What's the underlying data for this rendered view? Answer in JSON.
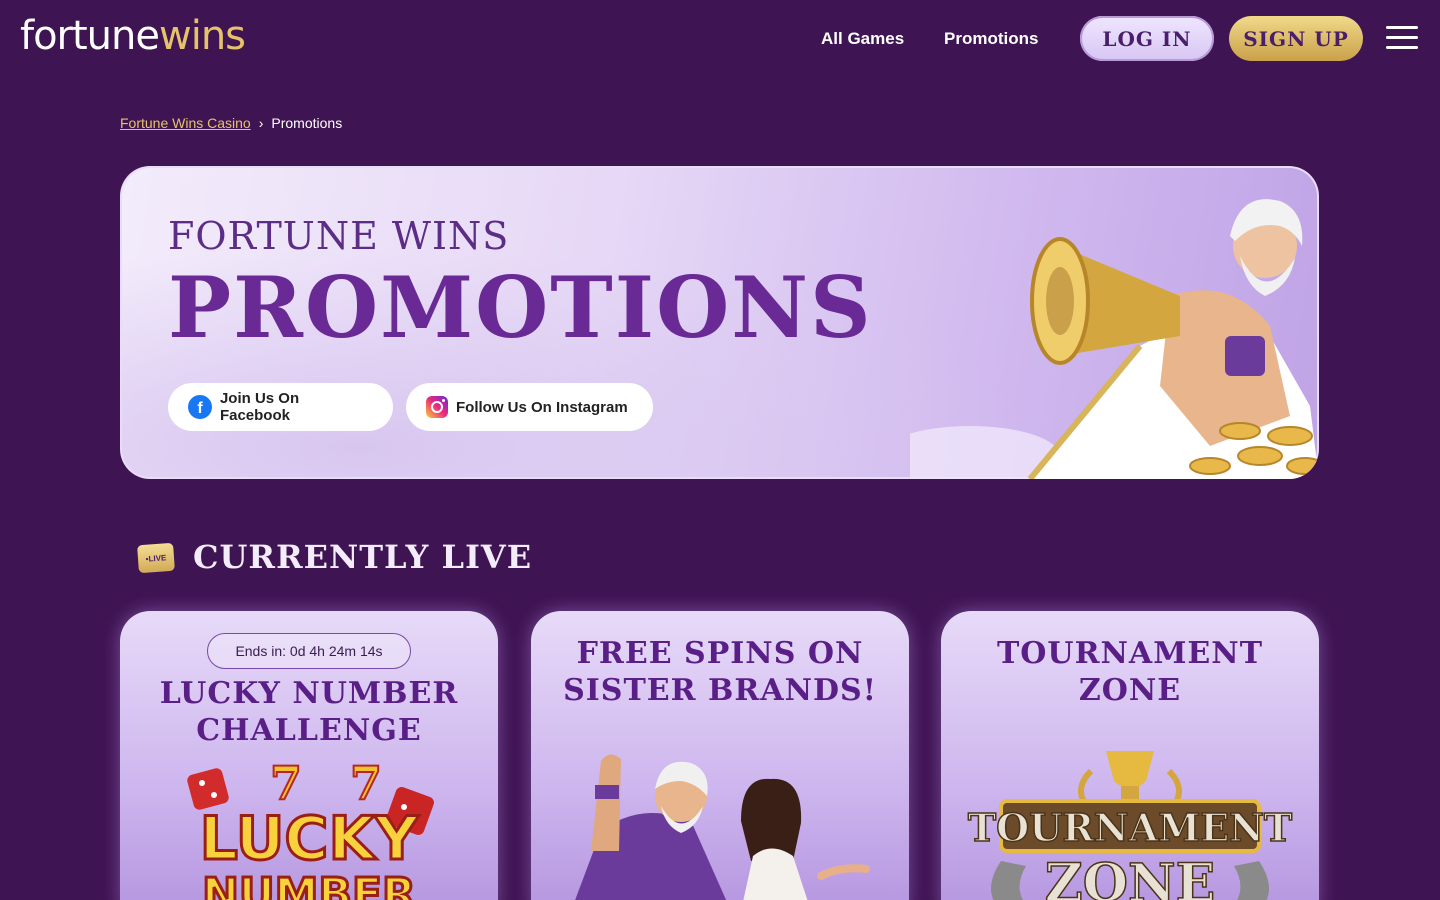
{
  "header": {
    "logo_part1": "fortune",
    "logo_part2": "wins",
    "nav": [
      "All Games",
      "Promotions"
    ],
    "login_label": "LOG IN",
    "signup_label": "SIGN UP"
  },
  "breadcrumb": {
    "home": "Fortune Wins Casino",
    "separator": "›",
    "current": "Promotions"
  },
  "hero": {
    "subtitle": "FORTUNE WINS",
    "title": "PROMOTIONS",
    "facebook_label": "Join Us On Facebook",
    "instagram_label": "Follow Us On Instagram"
  },
  "live_section": {
    "badge": "•LIVE",
    "title": "CURRENTLY LIVE",
    "cards": [
      {
        "timer": "Ends in: 0d 4h 24m 14s",
        "title_line1": "LUCKY NUMBER",
        "title_line2": "CHALLENGE",
        "art_text1": "LUCKY",
        "art_text2": "NUMBER"
      },
      {
        "title_line1": "FREE SPINS ON",
        "title_line2": "SISTER BRANDS!"
      },
      {
        "title_line1": "TOURNAMENT",
        "title_line2": "ZONE",
        "art_text1": "TOURNAMENT",
        "art_text2": "ZONE"
      }
    ]
  },
  "colors": {
    "background": "#3f1453",
    "gold": "#e6c36b",
    "purple_text": "#6a2a96"
  }
}
